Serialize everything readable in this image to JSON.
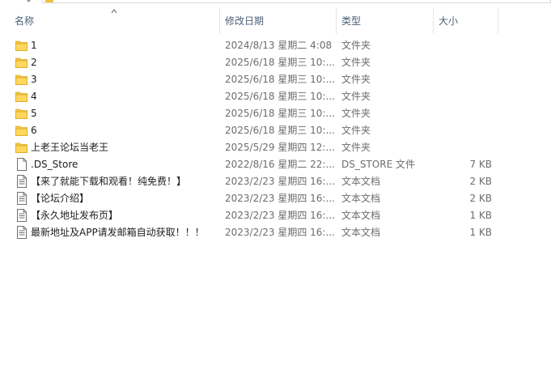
{
  "columns": {
    "name": "名称",
    "date": "修改日期",
    "type": "类型",
    "size": "大小"
  },
  "files": [
    {
      "icon": "folder-icon",
      "name": "1",
      "date": "2024/8/13 星期二 4:08",
      "type": "文件夹",
      "size": ""
    },
    {
      "icon": "folder-icon",
      "name": "2",
      "date": "2025/6/18 星期三 10:...",
      "type": "文件夹",
      "size": ""
    },
    {
      "icon": "folder-icon",
      "name": "3",
      "date": "2025/6/18 星期三 10:...",
      "type": "文件夹",
      "size": ""
    },
    {
      "icon": "folder-icon",
      "name": "4",
      "date": "2025/6/18 星期三 10:...",
      "type": "文件夹",
      "size": ""
    },
    {
      "icon": "folder-icon",
      "name": "5",
      "date": "2025/6/18 星期三 10:...",
      "type": "文件夹",
      "size": ""
    },
    {
      "icon": "folder-icon",
      "name": "6",
      "date": "2025/6/18 星期三 10:...",
      "type": "文件夹",
      "size": ""
    },
    {
      "icon": "folder-icon",
      "name": "上老王论坛当老王",
      "date": "2025/5/29 星期四 12:...",
      "type": "文件夹",
      "size": ""
    },
    {
      "icon": "file-icon",
      "name": ".DS_Store",
      "date": "2022/8/16 星期二 22:...",
      "type": "DS_STORE 文件",
      "size": "7 KB"
    },
    {
      "icon": "text-file-icon",
      "name": "【来了就能下载和观看！纯免费！】",
      "date": "2023/2/23 星期四 16:...",
      "type": "文本文档",
      "size": "2 KB"
    },
    {
      "icon": "text-file-icon",
      "name": "【论坛介绍】",
      "date": "2023/2/23 星期四 16:...",
      "type": "文本文档",
      "size": "2 KB"
    },
    {
      "icon": "text-file-icon",
      "name": "【永久地址发布页】",
      "date": "2023/2/23 星期四 16:...",
      "type": "文本文档",
      "size": "1 KB"
    },
    {
      "icon": "text-file-icon",
      "name": "最新地址及APP请发邮箱自动获取！！！",
      "date": "2023/2/23 星期四 16:...",
      "type": "文本文档",
      "size": "1 KB"
    }
  ],
  "colors": {
    "folder": "#f4c843",
    "header_text": "#4c607a",
    "secondary_text": "#6d6d6d"
  }
}
